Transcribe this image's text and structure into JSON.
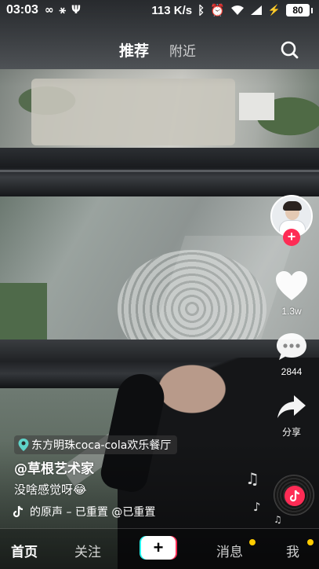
{
  "status_bar": {
    "time": "03:03",
    "net_speed": "113 K/s",
    "battery": "80"
  },
  "top_nav": {
    "tabs": [
      {
        "label": "推荐",
        "active": true
      },
      {
        "label": "附近",
        "active": false
      }
    ]
  },
  "right_rail": {
    "like_count": "1.3w",
    "comment_count": "2844",
    "share_label": "分享"
  },
  "video_info": {
    "location": "东方明珠coca-cola欢乐餐厅",
    "author": "@草根艺术家",
    "caption": "没啥感觉呀😂",
    "music": "的原声 – 已重置    @已重置"
  },
  "tab_bar": {
    "home": "首页",
    "follow": "关注",
    "create": "+",
    "messages": "消息",
    "me": "我"
  },
  "colors": {
    "accent_red": "#fe2c55",
    "accent_cyan": "#25f4ee",
    "badge_yellow": "#ffcc00"
  }
}
